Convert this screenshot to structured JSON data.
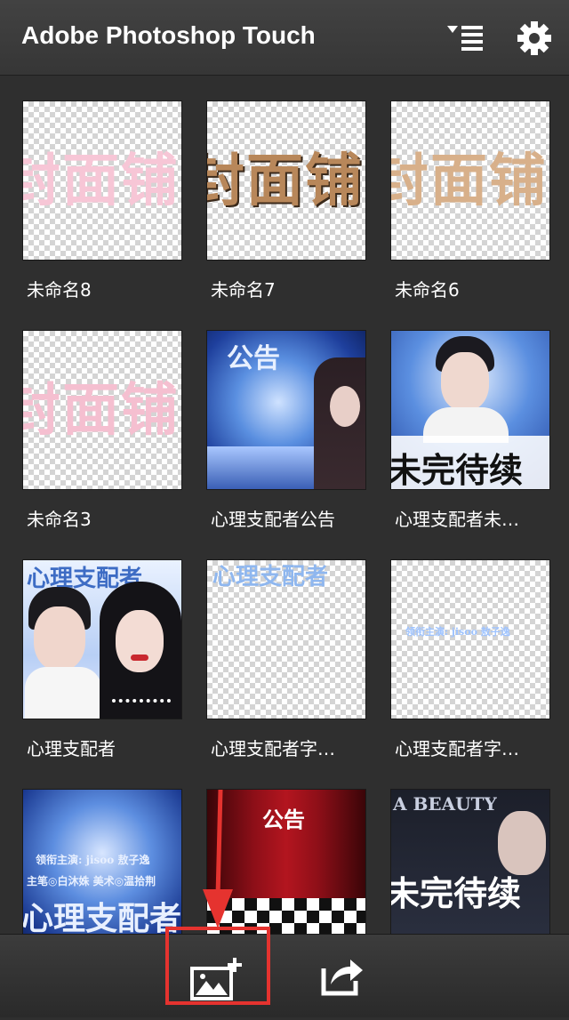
{
  "header": {
    "title": "Adobe Photoshop Touch",
    "sort_icon": "sort-list-icon",
    "settings_icon": "gear-icon"
  },
  "projects": [
    {
      "label": "未命名8",
      "thumb_text": "封面铺"
    },
    {
      "label": "未命名7",
      "thumb_text": "封面铺"
    },
    {
      "label": "未命名6",
      "thumb_text": "封面铺"
    },
    {
      "label": "未命名3",
      "thumb_text": "封面铺"
    },
    {
      "label": "心理支配者公告",
      "thumb_text": "公告"
    },
    {
      "label": "心理支配者未…",
      "thumb_text": "未完待续"
    },
    {
      "label": "心理支配者",
      "thumb_text": "心理支配者"
    },
    {
      "label": "心理支配者字…",
      "thumb_text": "心理支配者"
    },
    {
      "label": "心理支配者字…",
      "thumb_text": "领衔主演: jisoo 敖子逸"
    },
    {
      "thumb_text": "心理支配者",
      "thumb_subtext": "领衔主演: jisoo 敖子逸",
      "thumb_subtext2": "主笔◎白沐姝  美术◎温拾荆"
    },
    {
      "thumb_text": "公告"
    },
    {
      "thumb_text": "未完待续",
      "thumb_subtext": "A BEAUTY"
    }
  ],
  "toolbar": {
    "new_image_icon": "add-image-icon",
    "share_icon": "share-icon"
  },
  "colors": {
    "highlight": "#e5332f",
    "background": "#2f2f2f"
  }
}
